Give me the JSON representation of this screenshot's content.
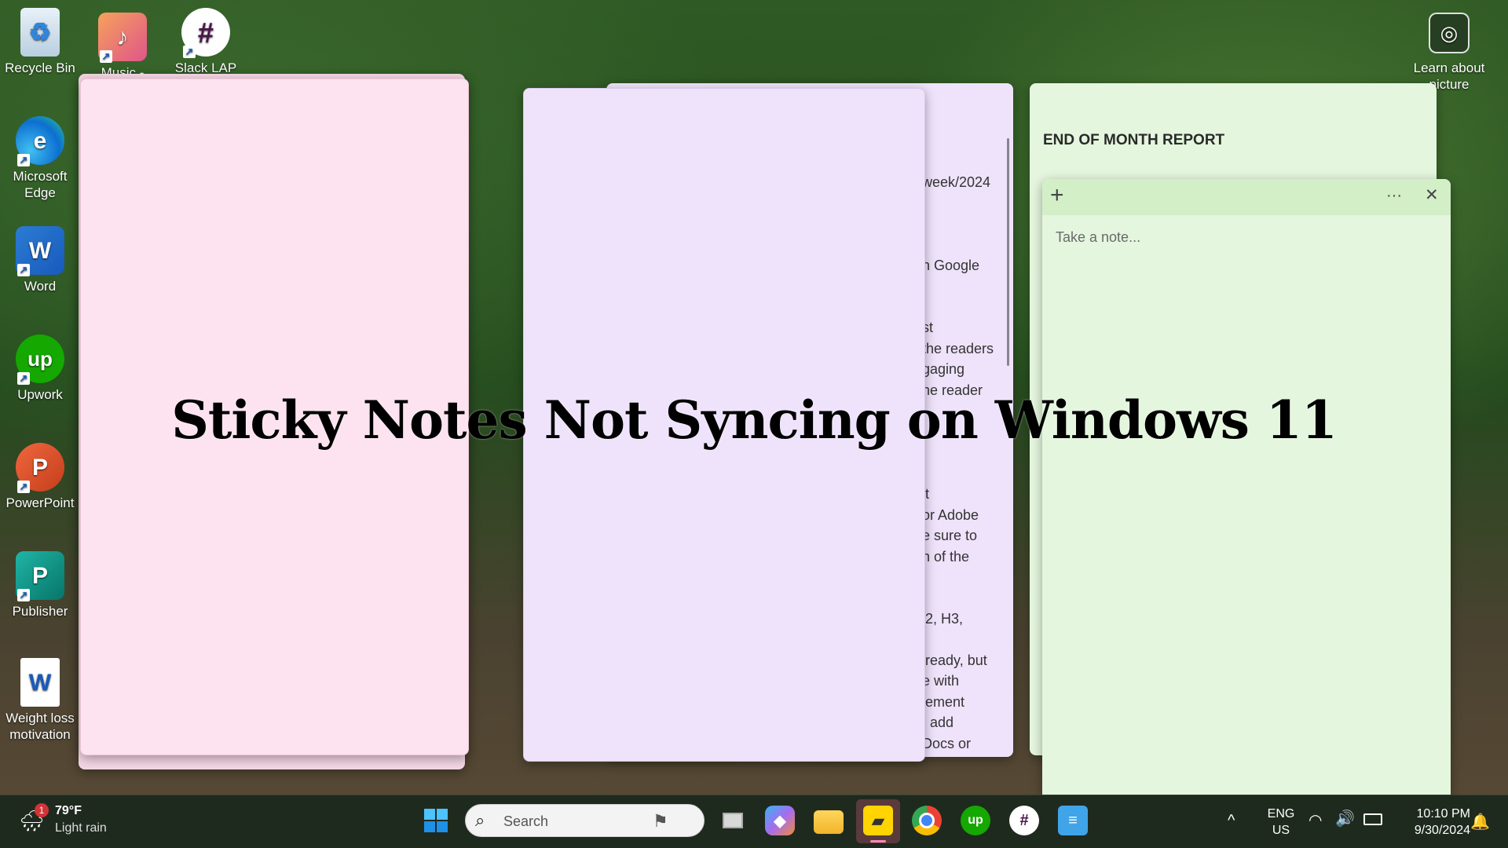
{
  "desktop": {
    "icons": [
      {
        "label": "Recycle Bin"
      },
      {
        "label": "Music -"
      },
      {
        "label": "Slack LAP"
      },
      {
        "label": "Microsoft Edge"
      },
      {
        "label": "Word"
      },
      {
        "label": "Upwork"
      },
      {
        "label": "PowerPoint"
      },
      {
        "label": "Publisher"
      },
      {
        "label": "Weight loss motivation"
      }
    ],
    "learn_about": "Learn about picture"
  },
  "notes": {
    "back_note_fragments": [
      "week/2024",
      "n Google",
      "st",
      "the readers",
      "gaging",
      "he reader",
      "lt",
      "or Adobe",
      "e sure to",
      "n of the",
      "l2, H3,",
      "lready, but",
      "e with",
      "lement",
      ", add",
      "Docs or"
    ],
    "green_list_title": "END OF MONTH REPORT",
    "editor": {
      "placeholder": "Take a note...",
      "add_symbol": "+",
      "menu_symbol": "···",
      "close_symbol": "✕"
    }
  },
  "overlay_title": "Sticky Notes Not Syncing on Windows 11",
  "taskbar": {
    "weather": {
      "badge": "1",
      "temp": "79°F",
      "condition": "Light rain"
    },
    "search_placeholder": "Search",
    "language": {
      "line1": "ENG",
      "line2": "US"
    },
    "clock": {
      "time": "10:10 PM",
      "date": "9/30/2024"
    },
    "tray_chevron": "^"
  },
  "colors": {
    "pink_note": "#fde3ef",
    "purple_note": "#efe3fb",
    "green_note": "#e4f6de",
    "green_header": "#d2efc8",
    "taskbar": "#1f2a1f"
  },
  "icons": {
    "start": "windows-start-icon",
    "search": "search-icon",
    "taskview": "task-view-icon",
    "copilot": "copilot-icon",
    "explorer": "file-explorer-icon",
    "sticky": "sticky-notes-icon",
    "chrome": "chrome-icon",
    "upwork": "upwork-icon",
    "slack": "slack-icon",
    "notepad": "notepad-icon"
  }
}
